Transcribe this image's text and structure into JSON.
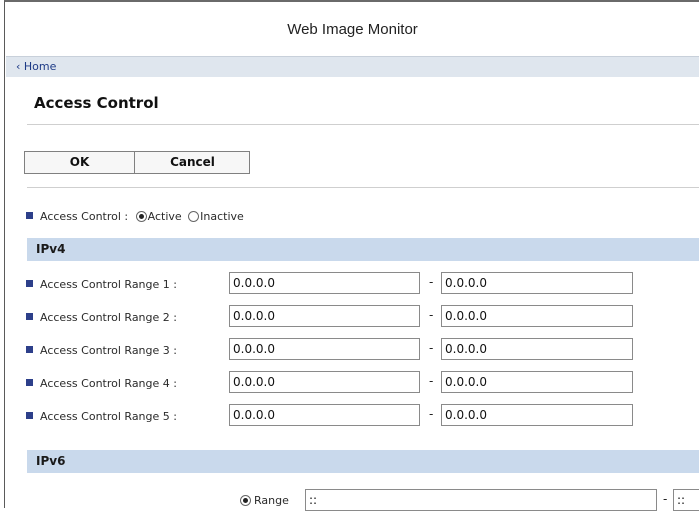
{
  "window": {
    "title": "Web Image Monitor"
  },
  "nav": {
    "home": "‹ Home"
  },
  "page": {
    "title": "Access Control"
  },
  "buttons": {
    "ok": "OK",
    "cancel": "Cancel"
  },
  "access_control": {
    "label": "Access Control :",
    "options": [
      {
        "label": "Active",
        "checked": true
      },
      {
        "label": "Inactive",
        "checked": false
      }
    ]
  },
  "ipv4": {
    "header": "IPv4",
    "ranges": [
      {
        "label": "Access Control Range 1 :",
        "start": "0.0.0.0",
        "end": "0.0.0.0"
      },
      {
        "label": "Access Control Range 2 :",
        "start": "0.0.0.0",
        "end": "0.0.0.0"
      },
      {
        "label": "Access Control Range 3 :",
        "start": "0.0.0.0",
        "end": "0.0.0.0"
      },
      {
        "label": "Access Control Range 4 :",
        "start": "0.0.0.0",
        "end": "0.0.0.0"
      },
      {
        "label": "Access Control Range 5 :",
        "start": "0.0.0.0",
        "end": "0.0.0.0"
      }
    ],
    "separator": "-"
  },
  "ipv6": {
    "header": "IPv6",
    "range_option": {
      "label": "Range",
      "checked": true
    },
    "range_start": "::",
    "range_end": "::",
    "separator": "-"
  },
  "colors": {
    "section_header": "#c9d9ec",
    "bullet": "#2d3f8a",
    "link": "#1d3a86"
  }
}
